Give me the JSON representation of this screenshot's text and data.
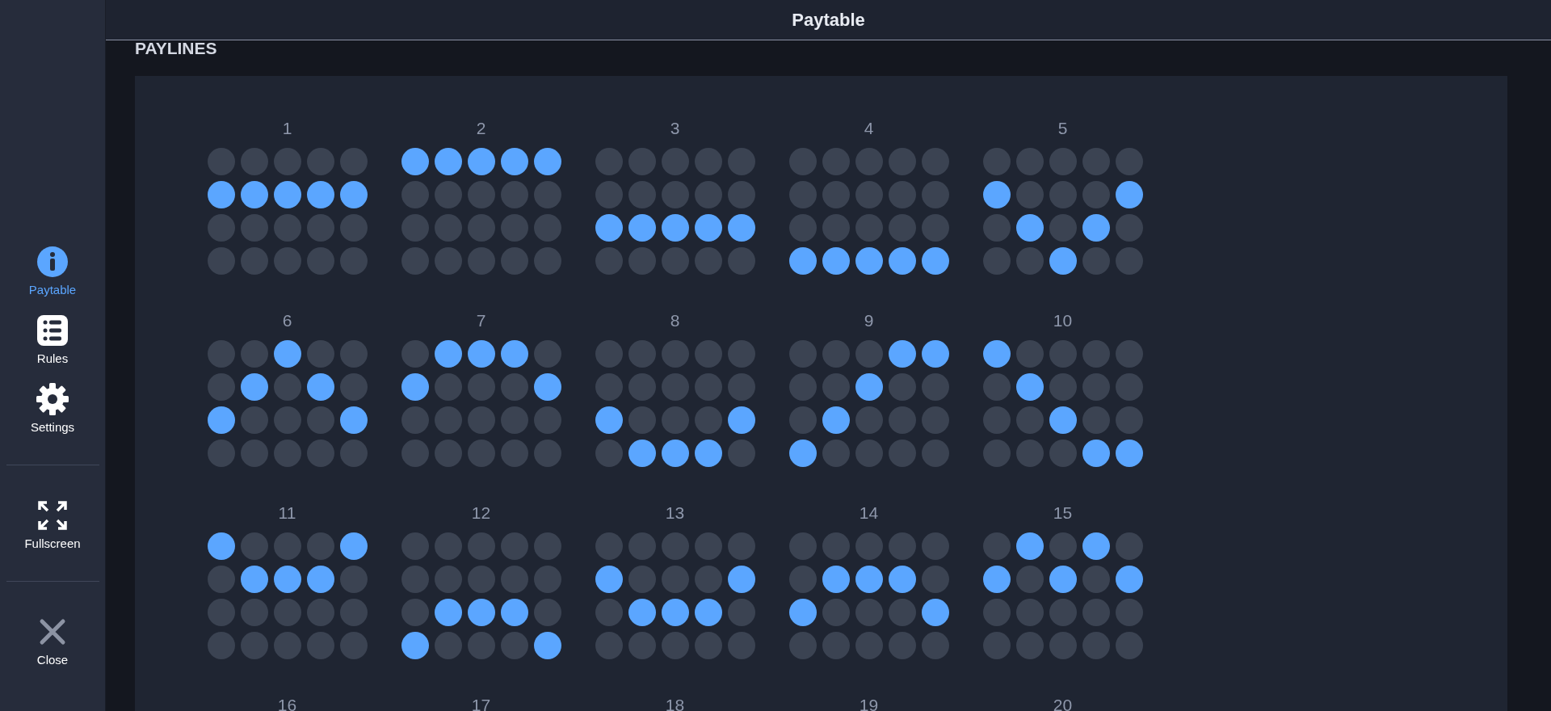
{
  "header": {
    "title": "Paytable"
  },
  "sidebar": {
    "items": [
      {
        "kind": "info",
        "label": "Paytable",
        "selected": true
      },
      {
        "kind": "list",
        "label": "Rules",
        "selected": false
      },
      {
        "kind": "gear",
        "label": "Settings",
        "selected": false
      },
      {
        "kind": "fullscreen",
        "label": "Fullscreen",
        "selected": false
      },
      {
        "kind": "close",
        "label": "Close",
        "selected": false
      }
    ]
  },
  "section_title": "PAYLINES",
  "paylines": [
    {
      "number": "1",
      "grid": [
        [
          false,
          false,
          false,
          false,
          false
        ],
        [
          true,
          true,
          true,
          true,
          true
        ],
        [
          false,
          false,
          false,
          false,
          false
        ],
        [
          false,
          false,
          false,
          false,
          false
        ]
      ]
    },
    {
      "number": "2",
      "grid": [
        [
          true,
          true,
          true,
          true,
          true
        ],
        [
          false,
          false,
          false,
          false,
          false
        ],
        [
          false,
          false,
          false,
          false,
          false
        ],
        [
          false,
          false,
          false,
          false,
          false
        ]
      ]
    },
    {
      "number": "3",
      "grid": [
        [
          false,
          false,
          false,
          false,
          false
        ],
        [
          false,
          false,
          false,
          false,
          false
        ],
        [
          true,
          true,
          true,
          true,
          true
        ],
        [
          false,
          false,
          false,
          false,
          false
        ]
      ]
    },
    {
      "number": "4",
      "grid": [
        [
          false,
          false,
          false,
          false,
          false
        ],
        [
          false,
          false,
          false,
          false,
          false
        ],
        [
          false,
          false,
          false,
          false,
          false
        ],
        [
          true,
          true,
          true,
          true,
          true
        ]
      ]
    },
    {
      "number": "5",
      "grid": [
        [
          false,
          false,
          false,
          false,
          false
        ],
        [
          true,
          false,
          false,
          false,
          true
        ],
        [
          false,
          true,
          false,
          true,
          false
        ],
        [
          false,
          false,
          true,
          false,
          false
        ]
      ]
    },
    {
      "number": "6",
      "grid": [
        [
          false,
          false,
          true,
          false,
          false
        ],
        [
          false,
          true,
          false,
          true,
          false
        ],
        [
          true,
          false,
          false,
          false,
          true
        ],
        [
          false,
          false,
          false,
          false,
          false
        ]
      ]
    },
    {
      "number": "7",
      "grid": [
        [
          false,
          true,
          true,
          true,
          false
        ],
        [
          true,
          false,
          false,
          false,
          true
        ],
        [
          false,
          false,
          false,
          false,
          false
        ],
        [
          false,
          false,
          false,
          false,
          false
        ]
      ]
    },
    {
      "number": "8",
      "grid": [
        [
          false,
          false,
          false,
          false,
          false
        ],
        [
          false,
          false,
          false,
          false,
          false
        ],
        [
          true,
          false,
          false,
          false,
          true
        ],
        [
          false,
          true,
          true,
          true,
          false
        ]
      ]
    },
    {
      "number": "9",
      "grid": [
        [
          false,
          false,
          false,
          true,
          true
        ],
        [
          false,
          false,
          true,
          false,
          false
        ],
        [
          false,
          true,
          false,
          false,
          false
        ],
        [
          true,
          false,
          false,
          false,
          false
        ]
      ]
    },
    {
      "number": "10",
      "grid": [
        [
          true,
          false,
          false,
          false,
          false
        ],
        [
          false,
          true,
          false,
          false,
          false
        ],
        [
          false,
          false,
          true,
          false,
          false
        ],
        [
          false,
          false,
          false,
          true,
          true
        ]
      ]
    },
    {
      "number": "11",
      "grid": [
        [
          true,
          false,
          false,
          false,
          true
        ],
        [
          false,
          true,
          true,
          true,
          false
        ],
        [
          false,
          false,
          false,
          false,
          false
        ],
        [
          false,
          false,
          false,
          false,
          false
        ]
      ]
    },
    {
      "number": "12",
      "grid": [
        [
          false,
          false,
          false,
          false,
          false
        ],
        [
          false,
          false,
          false,
          false,
          false
        ],
        [
          false,
          true,
          true,
          true,
          false
        ],
        [
          true,
          false,
          false,
          false,
          true
        ]
      ]
    },
    {
      "number": "13",
      "grid": [
        [
          false,
          false,
          false,
          false,
          false
        ],
        [
          true,
          false,
          false,
          false,
          true
        ],
        [
          false,
          true,
          true,
          true,
          false
        ],
        [
          false,
          false,
          false,
          false,
          false
        ]
      ]
    },
    {
      "number": "14",
      "grid": [
        [
          false,
          false,
          false,
          false,
          false
        ],
        [
          false,
          true,
          true,
          true,
          false
        ],
        [
          true,
          false,
          false,
          false,
          true
        ],
        [
          false,
          false,
          false,
          false,
          false
        ]
      ]
    },
    {
      "number": "15",
      "grid": [
        [
          false,
          true,
          false,
          true,
          false
        ],
        [
          true,
          false,
          true,
          false,
          true
        ],
        [
          false,
          false,
          false,
          false,
          false
        ],
        [
          false,
          false,
          false,
          false,
          false
        ]
      ]
    },
    {
      "number": "16"
    },
    {
      "number": "17"
    },
    {
      "number": "18"
    },
    {
      "number": "19"
    },
    {
      "number": "20"
    }
  ]
}
